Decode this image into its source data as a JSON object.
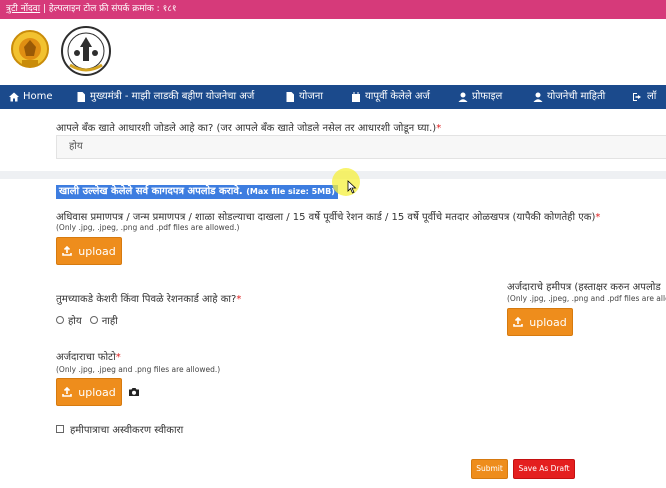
{
  "topbar": {
    "skip_link": "त्रुटी नोंदवा",
    "helpline": " | हेल्पलाइन टोल फ्री संपर्क क्रमांक : १८१"
  },
  "nav": {
    "items": [
      {
        "label": "Home",
        "icon": "home-icon"
      },
      {
        "label": "मुख्यमंत्री - माझी लाडकी बहीण योजनेचा अर्ज",
        "icon": "document-icon"
      },
      {
        "label": "योजना",
        "icon": "document-icon"
      },
      {
        "label": "यापूर्वी केलेले अर्ज",
        "icon": "calendar-icon"
      },
      {
        "label": "प्रोफाइल",
        "icon": "user-icon"
      },
      {
        "label": "योजनेची माहिती",
        "icon": "user-icon"
      },
      {
        "label": "लॉ",
        "icon": "logout-icon"
      }
    ]
  },
  "form": {
    "bank_question": "आपले बँक खाते आधारशी जोडले आहे का? (जर आपले बँक खाते जोडले नसेल तर आधारशी जोडून घ्या.)",
    "required_mark": "*",
    "bank_answer": "होय",
    "section_title": "खाली उल्लेख केलेले सर्व कागदपत्र अपलोड करावे.",
    "section_note": "(Max file size: 5MB)",
    "doc1_label": "अधिवास प्रमाणपत्र / जन्म प्रमाणपत्र / शाळा सोडल्याचा दाखला / 15 वर्षे पूर्वीचे रेशन कार्ड / 15 वर्षे पूर्वीचे मतदार ओळखपत्र (यापैकी कोणतेही एक)",
    "doc1_hint": "(Only .jpg, .jpeg, .png and .pdf files are allowed.)",
    "upload_label": "upload",
    "ration_question": "तुमच्याकडे केशरी किंवा पिवळे रेशनकार्ड आहे का?",
    "ration_yes": "होय",
    "ration_no": "नाही",
    "undertaking_label": "अर्जदाराचे हमीपत्र (हस्ताक्षर करुन अपलोड",
    "undertaking_hint": "(Only .jpg, .jpeg, .png and .pdf files are allow",
    "photo_label": "अर्जदाराचा फोटो",
    "photo_hint": "(Only .jpg, .jpeg and .png files are allowed.)",
    "accept_label": "हमीपात्राचा अस्वीकरण स्वीकारा",
    "submit_label": "Submit",
    "draft_label": "Save As Draft"
  },
  "colors": {
    "topbar": "#d63a7a",
    "navbar": "#1b4a8c",
    "upload_button": "#ee8d1c",
    "draft_button": "#e41f1f",
    "section_highlight": "#3d7de0"
  }
}
